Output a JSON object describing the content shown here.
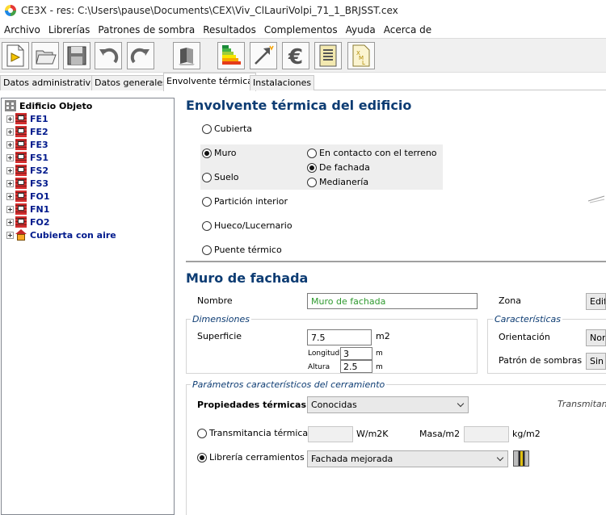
{
  "window": {
    "title": "CE3X - res: C:\\Users\\pause\\Documents\\CEX\\Viv_ClLauriVolpi_71_1_BRJSST.cex"
  },
  "menu": [
    "Archivo",
    "Librerías",
    "Patrones de sombra",
    "Resultados",
    "Complementos",
    "Ayuda",
    "Acerca de"
  ],
  "tabs": [
    "Datos administrativos",
    "Datos generales",
    "Envolvente térmica",
    "Instalaciones"
  ],
  "tree": {
    "root": "Edificio Objeto",
    "items": [
      "FE1",
      "FE2",
      "FE3",
      "FS1",
      "FS2",
      "FS3",
      "FO1",
      "FN1",
      "FO2"
    ],
    "last": "Cubierta con aire"
  },
  "envolvente": {
    "title": "Envolvente térmica del edificio",
    "options": [
      "Cubierta",
      "Muro",
      "Suelo",
      "Partición interior",
      "Hueco/Lucernario",
      "Puente térmico"
    ],
    "muro_options": [
      "En contacto con el terreno",
      "De fachada",
      "Medianería"
    ]
  },
  "muro": {
    "title": "Muro de fachada",
    "nombre_label": "Nombre",
    "nombre_value": "Muro de fachada",
    "zona_label": "Zona",
    "zona_value": "Edificio Objeto",
    "dimensiones_title": "Dimensiones",
    "superficie_label": "Superficie",
    "superficie_value": "7.5",
    "superficie_unit": "m2",
    "longitud_label": "Longitud",
    "longitud_value": "3",
    "longitud_unit": "m",
    "altura_label": "Altura",
    "altura_value": "2.5",
    "altura_unit": "m",
    "caracteristicas_title": "Características",
    "orientacion_label": "Orientación",
    "orientacion_value": "Norte",
    "patron_label": "Patrón de sombras",
    "patron_value": "Sin patrón",
    "parametros_title": "Parámetros característicos del cerramiento",
    "propiedades_label": "Propiedades térmicas",
    "propiedades_value": "Conocidas",
    "transmitancia_header": "Transmitancia",
    "transmitancia_label": "Transmitancia térmica",
    "transmitancia_unit": "W/m2K",
    "masa_label": "Masa/m2",
    "masa_unit": "kg/m2",
    "libreria_label": "Librería cerramientos",
    "libreria_value": "Fachada mejorada"
  }
}
